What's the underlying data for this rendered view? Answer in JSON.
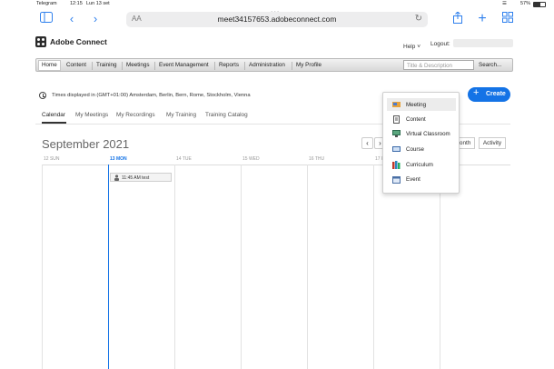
{
  "status_bar": {
    "carrier": "Telegram",
    "time": "12:15",
    "date": "Lun 13 set",
    "battery": "57%"
  },
  "browser": {
    "aa_label": "AA",
    "url": "meet34157653.adobeconnect.com"
  },
  "header": {
    "app_name": "Adobe Connect",
    "help_label": "Help",
    "logout_label": "Logout:"
  },
  "nav": {
    "items": [
      "Home",
      "Content",
      "Training",
      "Meetings",
      "Event Management",
      "Reports",
      "Administration",
      "My Profile"
    ],
    "search_placeholder": "Title & Description",
    "search_button": "Search..."
  },
  "timezone_text": "Times displayed in (GMT+01:00) Amsterdam, Berlin, Bern, Rome, Stockholm, Vienna",
  "create_button": "Create",
  "tabs": [
    "Calendar",
    "My Meetings",
    "My Recordings",
    "My Training",
    "Training Catalog"
  ],
  "calendar": {
    "month_title": "September 2021",
    "views": [
      "Month",
      "Activity"
    ],
    "days": [
      "12 SUN",
      "13 MON",
      "14 TUE",
      "15 WED",
      "16 THU",
      "17 F"
    ],
    "event": "11:45 AM test"
  },
  "create_menu": {
    "items": [
      {
        "label": "Meeting",
        "icon": "meeting-icon",
        "highlight": true
      },
      {
        "label": "Content",
        "icon": "content-icon"
      },
      {
        "label": "Virtual Classroom",
        "icon": "virtual-classroom-icon"
      },
      {
        "label": "Course",
        "icon": "course-icon"
      },
      {
        "label": "Curriculum",
        "icon": "curriculum-icon"
      },
      {
        "label": "Event",
        "icon": "event-icon"
      }
    ]
  },
  "colors": {
    "accent": "#1473e6",
    "today": "#1473e6"
  }
}
